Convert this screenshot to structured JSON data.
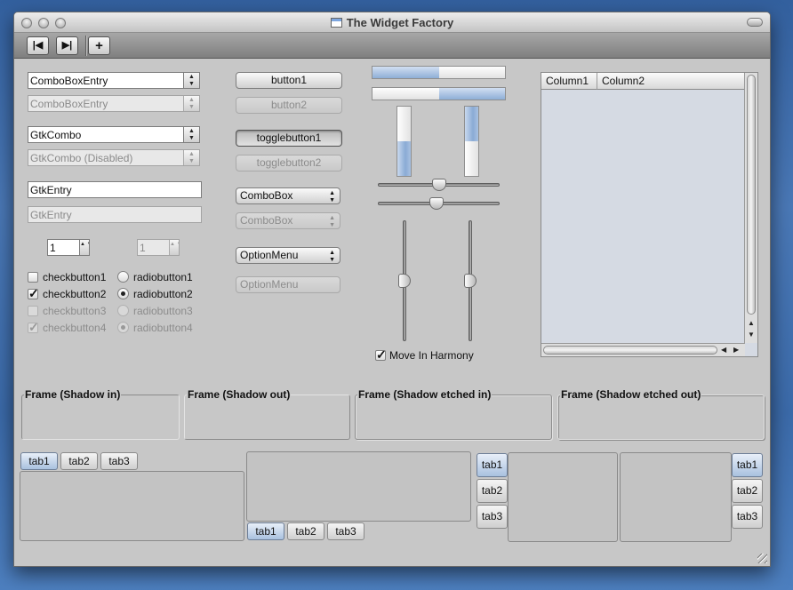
{
  "window": {
    "title": "The Widget Factory"
  },
  "toolbar": {
    "first_icon": "|◀",
    "last_icon": "▶|",
    "add_icon": "+"
  },
  "combos": {
    "combobox_entry": "ComboBoxEntry",
    "combobox_entry_disabled": "ComboBoxEntry",
    "gtk_combo": "GtkCombo",
    "gtk_combo_disabled": "GtkCombo (Disabled)",
    "entry": "GtkEntry",
    "entry_disabled": "GtkEntry",
    "spin_value": "1",
    "spin_value_disabled": "1",
    "spin_arrows": "▲\n▼"
  },
  "checks": {
    "items": [
      {
        "label": "checkbutton1",
        "checked": false,
        "disabled": false
      },
      {
        "label": "checkbutton2",
        "checked": true,
        "disabled": false
      },
      {
        "label": "checkbutton3",
        "checked": false,
        "disabled": true
      },
      {
        "label": "checkbutton4",
        "checked": true,
        "disabled": true
      }
    ],
    "mark": "✓"
  },
  "radios": {
    "items": [
      {
        "label": "radiobutton1",
        "selected": false,
        "disabled": false
      },
      {
        "label": "radiobutton2",
        "selected": true,
        "disabled": false
      },
      {
        "label": "radiobutton3",
        "selected": false,
        "disabled": true
      },
      {
        "label": "radiobutton4",
        "selected": true,
        "disabled": true
      }
    ]
  },
  "buttons": {
    "button1": "button1",
    "button2": "button2",
    "toggle1": "togglebutton1",
    "toggle2": "togglebutton2",
    "combobox": "ComboBox",
    "combobox_disabled": "ComboBox",
    "optionmenu": "OptionMenu",
    "optionmenu_disabled": "OptionMenu",
    "combo_arrows": "▲\n▼"
  },
  "progress": {
    "h1": 0.5,
    "h2": 0.5,
    "v1": 0.5,
    "v2": 0.5
  },
  "sliders": {
    "h1": 0.5,
    "h2": 0.5,
    "v1": 0.5,
    "v2": 0.5,
    "harmony_label": "Move In Harmony",
    "harmony_checked": true
  },
  "tree": {
    "columns": [
      "Column1",
      "Column2"
    ],
    "arrow_up": "▲",
    "arrow_down": "▼",
    "arrow_left": "◀",
    "arrow_right": "▶"
  },
  "frames": [
    "Frame (Shadow in)",
    "Frame (Shadow out)",
    "Frame (Shadow etched in)",
    "Frame (Shadow etched out)"
  ],
  "notebooks": {
    "tabs": [
      "tab1",
      "tab2",
      "tab3"
    ]
  }
}
